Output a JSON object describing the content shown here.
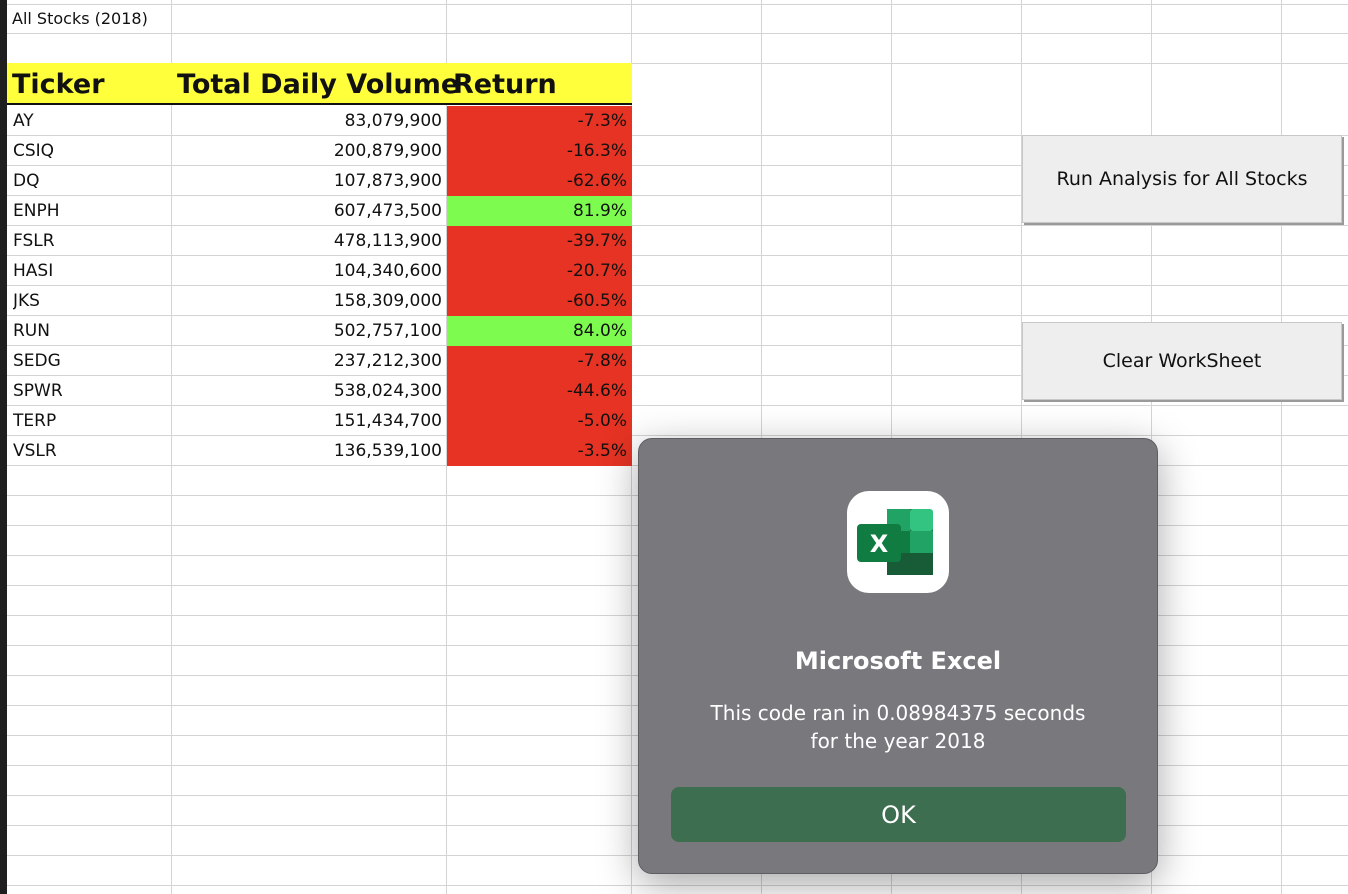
{
  "sheet": {
    "title": "All Stocks (2018)",
    "headers": {
      "ticker": "Ticker",
      "volume": "Total Daily Volume",
      "return": "Return"
    },
    "rows": [
      {
        "ticker": "AY",
        "volume": "83,079,900",
        "return": "-7.3%",
        "status": "negative"
      },
      {
        "ticker": "CSIQ",
        "volume": "200,879,900",
        "return": "-16.3%",
        "status": "negative"
      },
      {
        "ticker": "DQ",
        "volume": "107,873,900",
        "return": "-62.6%",
        "status": "negative"
      },
      {
        "ticker": "ENPH",
        "volume": "607,473,500",
        "return": "81.9%",
        "status": "positive"
      },
      {
        "ticker": "FSLR",
        "volume": "478,113,900",
        "return": "-39.7%",
        "status": "negative"
      },
      {
        "ticker": "HASI",
        "volume": "104,340,600",
        "return": "-20.7%",
        "status": "negative"
      },
      {
        "ticker": "JKS",
        "volume": "158,309,000",
        "return": "-60.5%",
        "status": "negative"
      },
      {
        "ticker": "RUN",
        "volume": "502,757,100",
        "return": "84.0%",
        "status": "positive"
      },
      {
        "ticker": "SEDG",
        "volume": "237,212,300",
        "return": "-7.8%",
        "status": "negative"
      },
      {
        "ticker": "SPWR",
        "volume": "538,024,300",
        "return": "-44.6%",
        "status": "negative"
      },
      {
        "ticker": "TERP",
        "volume": "151,434,700",
        "return": "-5.0%",
        "status": "negative"
      },
      {
        "ticker": "VSLR",
        "volume": "136,539,100",
        "return": "-3.5%",
        "status": "negative"
      }
    ]
  },
  "buttons": {
    "run_analysis": "Run Analysis for All Stocks",
    "clear_worksheet": "Clear WorkSheet"
  },
  "dialog": {
    "app_icon": "excel-app-icon",
    "icon_letter": "X",
    "title": "Microsoft Excel",
    "message_line1": "This code ran in 0.08984375 seconds",
    "message_line2": "for the year 2018",
    "ok_label": "OK"
  },
  "colors": {
    "header_fill": "#ffff3c",
    "positive_fill": "#7dfb4e",
    "negative_fill": "#e63323",
    "dialog_bg": "#79787d",
    "ok_button": "#3d6e4f"
  }
}
